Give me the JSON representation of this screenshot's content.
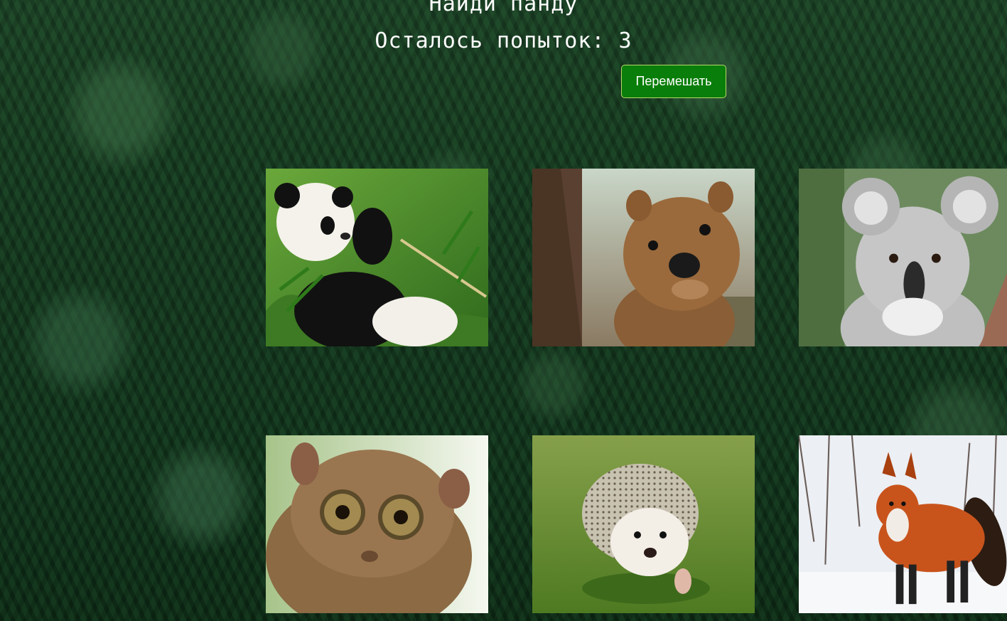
{
  "header": {
    "title": "Найди панду",
    "attempts_text": "Осталось попыток: 3",
    "shuffle_label": "Перемешать"
  },
  "cards": [
    {
      "animal": "panda"
    },
    {
      "animal": "quokka"
    },
    {
      "animal": "koala"
    },
    {
      "animal": "tarsier"
    },
    {
      "animal": "hedgehog"
    },
    {
      "animal": "fox"
    }
  ],
  "colors": {
    "button_bg": "#0a7e0a",
    "button_border": "#b8d86a",
    "text": "#ffffff",
    "forest": "#173e22"
  }
}
